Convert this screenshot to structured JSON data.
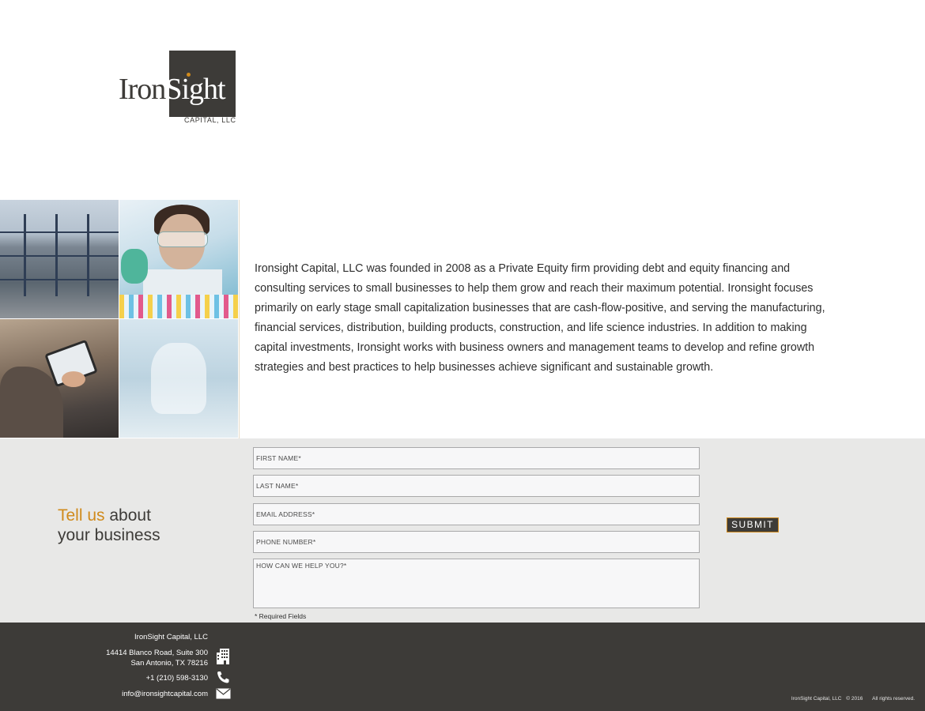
{
  "brand": {
    "logo_word_dark": "Iron",
    "logo_word_light": "Sight",
    "logo_sub": "CAPITAL, LLC",
    "accent_color": "#d08a1b",
    "dark_color": "#3d3b38"
  },
  "intro": {
    "text": "Ironsight Capital, LLC was founded in 2008 as a Private Equity firm providing debt and equity financing and consulting services to small businesses to help them grow and reach their maximum potential.  Ironsight focuses primarily on early stage small capitalization businesses that are cash-flow-positive, and serving the manufacturing, financial services, distribution, building products, construction, and life science industries. In addition to making capital investments, Ironsight works with business owners and management teams to develop and refine growth strategies and best practices to help businesses achieve significant and sustainable growth."
  },
  "contact": {
    "heading_accent": "Tell us",
    "heading_rest": " about",
    "heading_line2": "your business",
    "fields": {
      "first_name": {
        "placeholder": "FIRST NAME*",
        "value": ""
      },
      "last_name": {
        "placeholder": "LAST NAME*",
        "value": ""
      },
      "email": {
        "placeholder": "EMAIL ADDRESS*",
        "value": ""
      },
      "phone": {
        "placeholder": "PHONE NUMBER*",
        "value": ""
      },
      "message": {
        "placeholder": "HOW CAN WE HELP YOU?*",
        "value": ""
      }
    },
    "required_note": "* Required Fields",
    "submit_label": "SUBMIT"
  },
  "footer": {
    "company": "IronSight Capital, LLC",
    "address_line1": "14414 Blanco Road, Suite 300",
    "address_line2": "San Antonio, TX 78216",
    "phone": "+1 (210) 598-3130",
    "email": "info@ironsightcapital.com",
    "icons": [
      "building-icon",
      "phone-icon",
      "mail-icon"
    ],
    "copyright_company": "IronSight Capital, LLC",
    "copyright_year": "© 2016",
    "copyright_rights": "All rights reserved."
  }
}
